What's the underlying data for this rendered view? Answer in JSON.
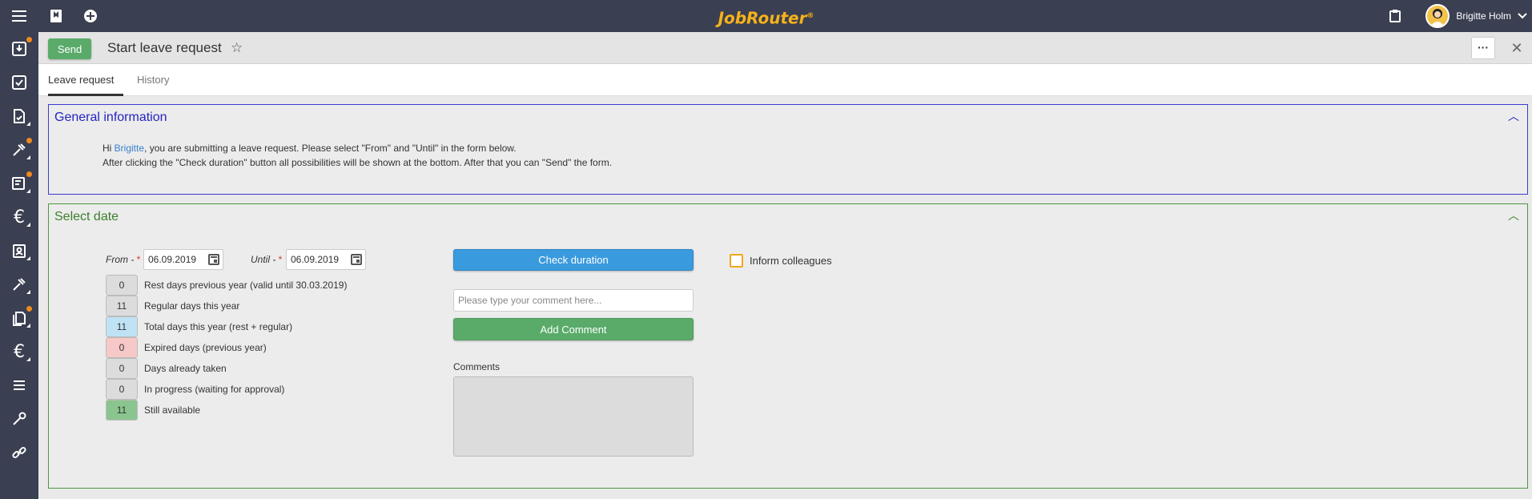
{
  "app": {
    "logo": "JobRouter",
    "logo_mark": "®"
  },
  "topbar": {
    "user_name": "Brigitte Holm"
  },
  "header": {
    "send_label": "Send",
    "title": "Start leave request",
    "more_label": "···",
    "close_label": "✕"
  },
  "tabs": [
    {
      "label": "Leave request",
      "active": true
    },
    {
      "label": "History",
      "active": false
    }
  ],
  "general": {
    "title": "General information",
    "line1_pre": "Hi ",
    "line1_name": "Brigitte",
    "line1_post": ", you are submitting a leave request. Please select \"From\" and \"Until\" in the form below.",
    "line2": "After clicking the \"Check duration\" button all possibilities will be shown at the bottom. After that you can \"Send\" the form."
  },
  "select_date": {
    "title": "Select date",
    "from_label": "From - ",
    "from_value": "06.09.2019",
    "until_label": "Until - ",
    "until_value": "06.09.2019",
    "required_mark": "*",
    "check_duration_label": "Check duration",
    "inform_label": "Inform colleagues",
    "comment_placeholder": "Please type your comment here...",
    "add_comment_label": "Add Comment",
    "comments_label": "Comments",
    "stats": [
      {
        "value": "0",
        "label": "Rest days previous year (valid until 30.03.2019)",
        "color": "#dcdcdc"
      },
      {
        "value": "11",
        "label": "Regular days this year",
        "color": "#dcdcdc"
      },
      {
        "value": "11",
        "label": "Total days this year (rest + regular)",
        "color": "#bfe3f5"
      },
      {
        "value": "0",
        "label": "Expired days (previous year)",
        "color": "#f7c8c8"
      },
      {
        "value": "0",
        "label": "Days already taken",
        "color": "#dcdcdc"
      },
      {
        "value": "0",
        "label": "In progress (waiting for approval)",
        "color": "#dcdcdc"
      },
      {
        "value": "11",
        "label": "Still available",
        "color": "#8ac48e"
      }
    ]
  },
  "colors": {
    "topbar": "#3a3f51",
    "logo": "#f7b21a",
    "send": "#5aab6a",
    "check": "#3a9ade",
    "general_border": "#3a3ad0",
    "date_border": "#4a9a3e"
  }
}
